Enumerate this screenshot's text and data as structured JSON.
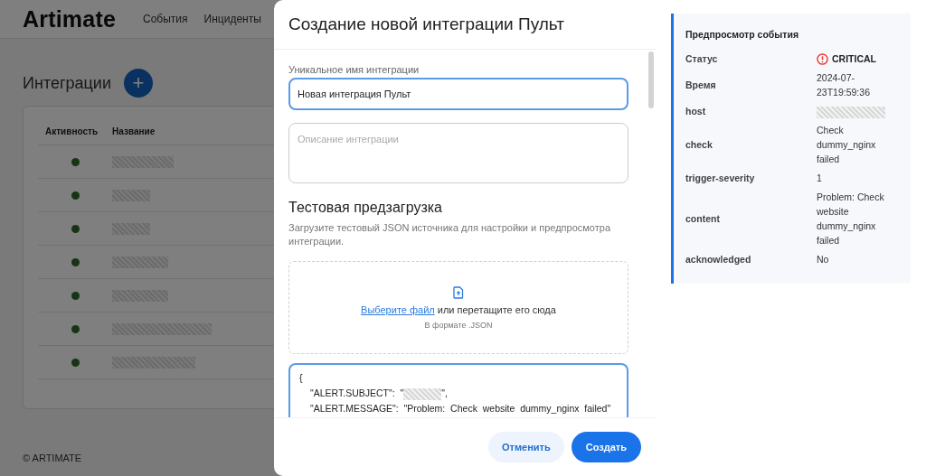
{
  "app": {
    "logo": "Artimate",
    "nav": [
      "События",
      "Инциденты"
    ],
    "footer": "© ARTIMATE"
  },
  "integrations": {
    "title": "Интеграции",
    "add_button": "+",
    "columns": [
      "Активность",
      "Название"
    ],
    "rows": [
      {
        "active": true,
        "name_redacted": true
      },
      {
        "active": true,
        "name_redacted": true
      },
      {
        "active": true,
        "name_redacted": true
      },
      {
        "active": true,
        "name_redacted": true
      },
      {
        "active": true,
        "name_redacted": true
      },
      {
        "active": true,
        "name_redacted": true
      },
      {
        "active": true,
        "name_redacted": true
      }
    ]
  },
  "drawer": {
    "title": "Создание новой интеграции Пульт",
    "name_field": {
      "label": "Уникальное имя интеграции",
      "value": "Новая интеграция Пульт",
      "focused": true
    },
    "description_field": {
      "placeholder": "Описание интеграции"
    },
    "section_title": "Тестовая предзагрузка",
    "section_text": "Загрузите тестовый JSON источника для настройки и предпросмотра интеграции.",
    "dropzone": {
      "link": "Выберите файл",
      "text": "или перетащите его сюда",
      "hint": "В формате .JSON"
    },
    "json_lines": [
      {
        "before": "{"
      },
      {
        "before": "\"ALERT.SUBJECT\":  \"",
        "redacted": true,
        "after": "\","
      },
      {
        "before": "\"ALERT.MESSAGE\":  \"Problem:  Check  website  dummy_nginx  failed\""
      }
    ],
    "buttons": [
      {
        "label": "Отменить",
        "kind": "secondary"
      },
      {
        "label": "Создать",
        "kind": "primary"
      }
    ]
  },
  "preview": {
    "title": "Предпросмотр события",
    "rows": [
      {
        "label": "Статус",
        "value": "CRITICAL",
        "kind": "status"
      },
      {
        "label": "Время",
        "value": "2024-07-23T19:59:36",
        "kind": "text"
      },
      {
        "label": "host",
        "kind": "redacted"
      },
      {
        "label": "check",
        "value": "Check dummy_nginx failed",
        "kind": "text"
      },
      {
        "label": "trigger-severity",
        "value": "1",
        "kind": "text"
      },
      {
        "label": "content",
        "value": "Problem: Check website dummy_nginx failed",
        "kind": "text"
      },
      {
        "label": "acknowledged",
        "value": "No",
        "kind": "text"
      }
    ]
  }
}
